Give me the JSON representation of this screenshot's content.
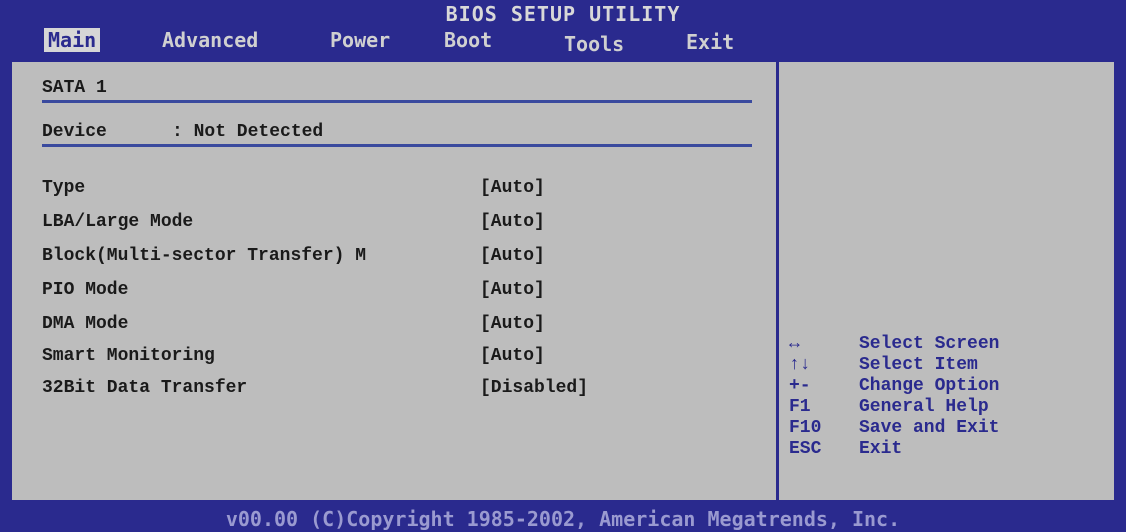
{
  "header": {
    "title": "BIOS SETUP UTILITY",
    "tabs": [
      "Main",
      "Advanced",
      "Power",
      "Boot",
      "Tools",
      "Exit"
    ],
    "active_tab": "Main"
  },
  "main": {
    "section": "SATA 1",
    "device_label": "Device",
    "device_value": ": Not Detected",
    "settings": [
      {
        "label": "Type",
        "value": "[Auto]"
      },
      {
        "label": "LBA/Large Mode",
        "value": "[Auto]"
      },
      {
        "label": "Block(Multi-sector Transfer) M",
        "value": "[Auto]"
      },
      {
        "label": "PIO Mode",
        "value": "[Auto]"
      },
      {
        "label": "DMA Mode",
        "value": "[Auto]"
      },
      {
        "label": "Smart Monitoring",
        "value": "[Auto]"
      },
      {
        "label": "32Bit Data Transfer",
        "value": "[Disabled]"
      }
    ]
  },
  "help": {
    "keys": [
      {
        "key": "↔",
        "desc": "Select Screen"
      },
      {
        "key": "↑↓",
        "desc": "Select Item"
      },
      {
        "key": "+-",
        "desc": "Change Option"
      },
      {
        "key": "F1",
        "desc": "General Help"
      },
      {
        "key": "F10",
        "desc": "Save and Exit"
      },
      {
        "key": "ESC",
        "desc": "Exit"
      }
    ]
  },
  "footer": {
    "text": "v00.00 (C)Copyright 1985-2002, American Megatrends, Inc."
  },
  "colors": {
    "background": "#2a2a8e",
    "panel": "#bdbdbd",
    "accent": "#3a4a9e"
  }
}
